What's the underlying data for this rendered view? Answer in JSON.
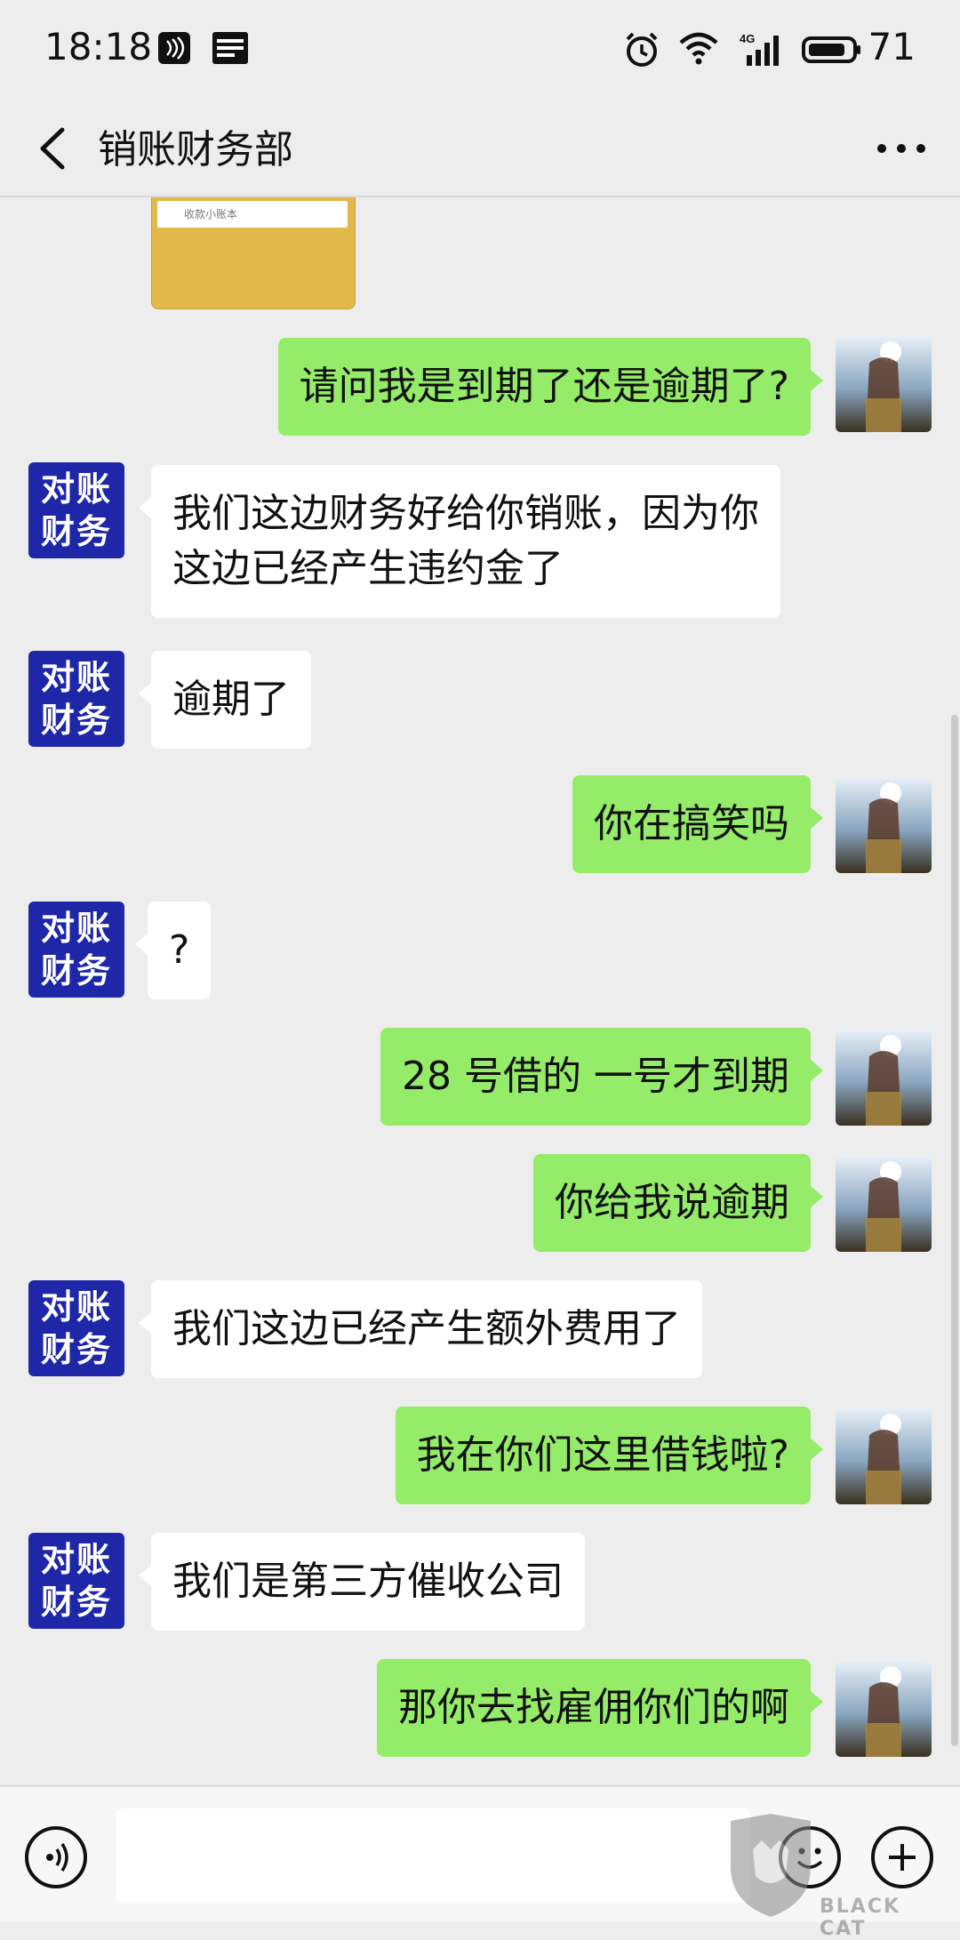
{
  "status_bar": {
    "time": "18:18",
    "battery": "71",
    "network": "4G"
  },
  "header": {
    "title": "销账财务部",
    "back_icon": "chevron-left-icon",
    "more_icon": "more-horizontal-icon"
  },
  "contact_avatar": {
    "line1": "对账",
    "line2": "财务"
  },
  "image_card": {
    "text": "收款小账本"
  },
  "messages": [
    {
      "side": "out",
      "text": "请问我是到期了还是逾期了?"
    },
    {
      "side": "in",
      "text": "我们这边财务好给你销账，因为你\n这边已经产生违约金了"
    },
    {
      "side": "in",
      "text": "逾期了"
    },
    {
      "side": "out",
      "text": "你在搞笑吗"
    },
    {
      "side": "in",
      "text": "?"
    },
    {
      "side": "out",
      "text": "28 号借的 一号才到期"
    },
    {
      "side": "out",
      "text": "你给我说逾期"
    },
    {
      "side": "in",
      "text": "我们这边已经产生额外费用了"
    },
    {
      "side": "out",
      "text": "我在你们这里借钱啦?"
    },
    {
      "side": "in",
      "text": "我们是第三方催收公司"
    },
    {
      "side": "out",
      "text": "那你去找雇佣你们的啊"
    }
  ],
  "input_bar": {
    "placeholder": "",
    "voice_icon": "voice-icon",
    "emoji_icon": "emoji-icon",
    "plus_icon": "plus-icon"
  },
  "watermark": {
    "text": "BLACK CAT"
  },
  "colors": {
    "background": "#ededed",
    "outgoing_bubble": "#95ec69",
    "incoming_bubble": "#ffffff",
    "avatar_blue": "#1e27a8"
  }
}
